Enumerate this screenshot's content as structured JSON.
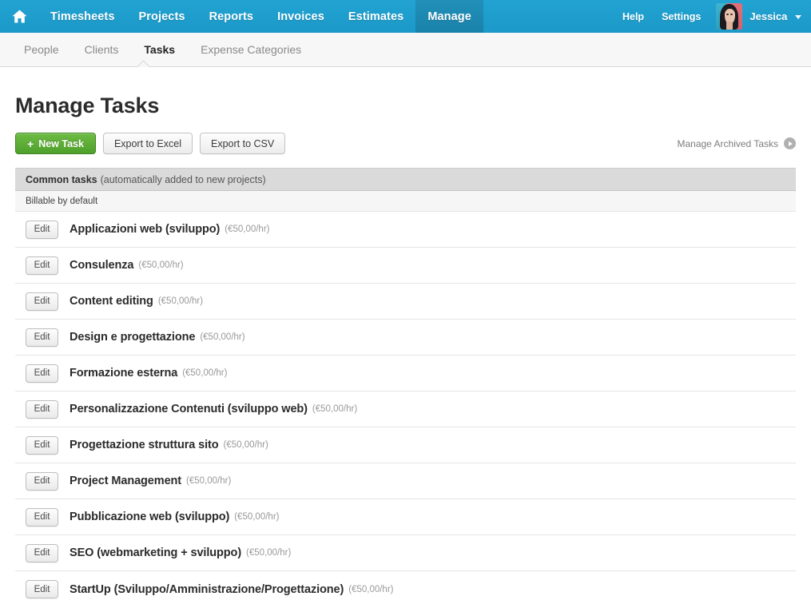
{
  "topnav": {
    "home_icon": "home-icon",
    "items": [
      {
        "label": "Timesheets",
        "active": false
      },
      {
        "label": "Projects",
        "active": false
      },
      {
        "label": "Reports",
        "active": false
      },
      {
        "label": "Invoices",
        "active": false
      },
      {
        "label": "Estimates",
        "active": false
      },
      {
        "label": "Manage",
        "active": true
      }
    ],
    "help_label": "Help",
    "settings_label": "Settings",
    "user_name": "Jessica",
    "caret_icon": "chevron-down-icon",
    "avatar_icon": "user-avatar",
    "bg_color": "#1b9dcd",
    "active_bg_color": "#1b87b0"
  },
  "subnav": {
    "items": [
      {
        "label": "People",
        "active": false
      },
      {
        "label": "Clients",
        "active": false
      },
      {
        "label": "Tasks",
        "active": true
      },
      {
        "label": "Expense Categories",
        "active": false
      }
    ]
  },
  "page": {
    "title": "Manage Tasks"
  },
  "toolbar": {
    "new_task_plus": "+",
    "new_task_label": "New Task",
    "export_excel_label": "Export to Excel",
    "export_csv_label": "Export to CSV",
    "archived_label": "Manage Archived Tasks",
    "archived_icon": "play-circle-icon"
  },
  "panel": {
    "header_strong": "Common tasks",
    "header_note": "(automatically added to new projects)",
    "subhead": "Billable by default",
    "edit_label": "Edit",
    "tasks": [
      {
        "name": "Applicazioni web (sviluppo)",
        "rate": "(€50,00/hr)"
      },
      {
        "name": "Consulenza",
        "rate": "(€50,00/hr)"
      },
      {
        "name": "Content editing",
        "rate": "(€50,00/hr)"
      },
      {
        "name": "Design e progettazione",
        "rate": "(€50,00/hr)"
      },
      {
        "name": "Formazione esterna",
        "rate": "(€50,00/hr)"
      },
      {
        "name": "Personalizzazione Contenuti (sviluppo web)",
        "rate": "(€50,00/hr)"
      },
      {
        "name": "Progettazione struttura sito",
        "rate": "(€50,00/hr)"
      },
      {
        "name": "Project Management",
        "rate": "(€50,00/hr)"
      },
      {
        "name": "Pubblicazione web (sviluppo)",
        "rate": "(€50,00/hr)"
      },
      {
        "name": "SEO (webmarketing + sviluppo)",
        "rate": "(€50,00/hr)"
      },
      {
        "name": "StartUp (Sviluppo/Amministrazione/Progettazione)",
        "rate": "(€50,00/hr)"
      }
    ]
  }
}
